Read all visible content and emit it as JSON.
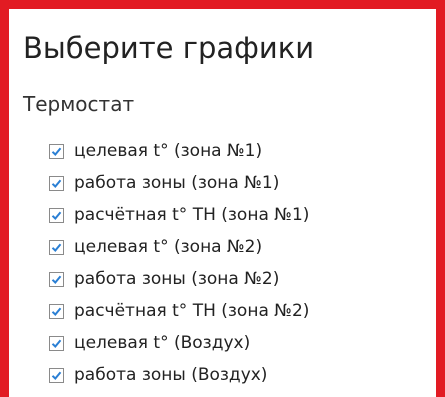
{
  "panel": {
    "title": "Выберите графики",
    "border_color": "#e21b23"
  },
  "section": {
    "title": "Термостат"
  },
  "check_color": "#2a7fd4",
  "options": [
    {
      "label": "целевая t° (зона №1)",
      "checked": true
    },
    {
      "label": "работа зоны (зона №1)",
      "checked": true
    },
    {
      "label": "расчётная t° ТН (зона №1)",
      "checked": true
    },
    {
      "label": "целевая t° (зона №2)",
      "checked": true
    },
    {
      "label": "работа зоны (зона №2)",
      "checked": true
    },
    {
      "label": "расчётная t° ТН (зона №2)",
      "checked": true
    },
    {
      "label": "целевая t° (Воздух)",
      "checked": true
    },
    {
      "label": "работа зоны (Воздух)",
      "checked": true
    }
  ]
}
